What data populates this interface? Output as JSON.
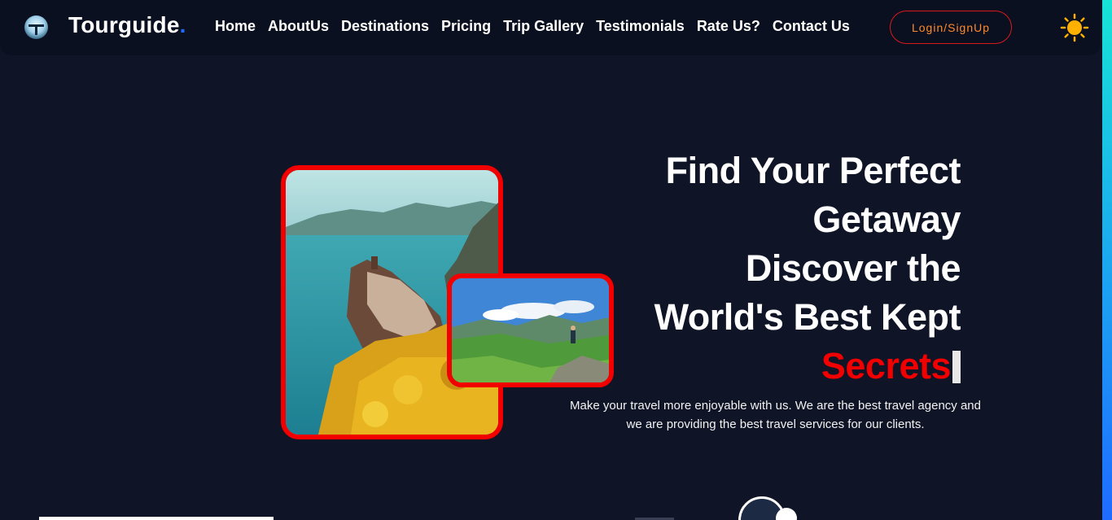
{
  "brand": {
    "name": "Tourguide",
    "dot": "."
  },
  "nav": {
    "items": [
      {
        "label": "Home"
      },
      {
        "label": "AboutUs"
      },
      {
        "label": "Destinations"
      },
      {
        "label": "Pricing"
      },
      {
        "label": "Trip Gallery"
      },
      {
        "label": "Testimonials"
      },
      {
        "label": "Rate Us?"
      },
      {
        "label": "Contact Us"
      }
    ],
    "login_label": "Login/SignUp",
    "theme_icon": "sun-icon"
  },
  "hero": {
    "title_lines": [
      "Find Your Perfect",
      "Getaway",
      "Discover the",
      "World's Best Kept"
    ],
    "accent_word": "Secrets",
    "description": "Make your travel more enjoyable with us. We are the best travel agency and we are providing the best travel services for our clients."
  },
  "colors": {
    "background": "#0f1427",
    "navbar": "#0b1020",
    "accent_red": "#f20000",
    "brand_dot": "#1f6bff",
    "login_text": "#ff8a2b",
    "sun": "#ffb000"
  }
}
